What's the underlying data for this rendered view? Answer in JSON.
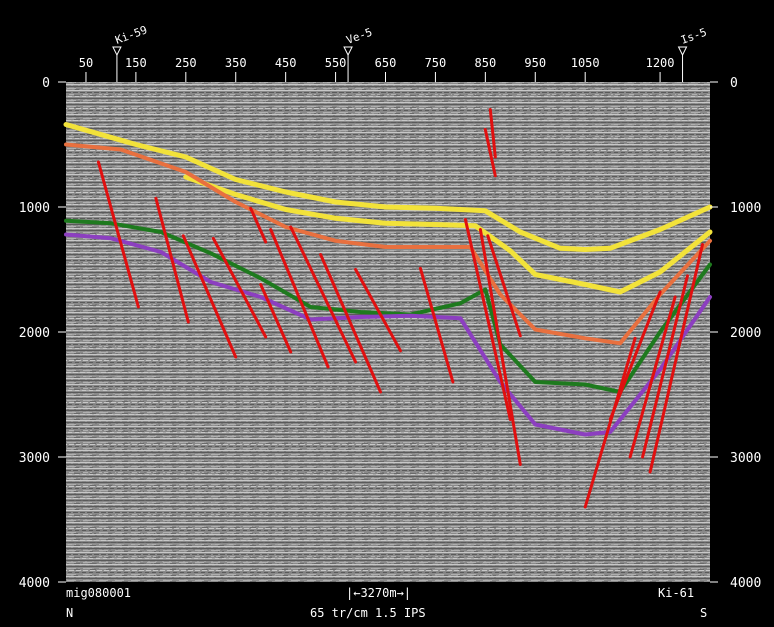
{
  "wells": [
    {
      "name": "Ki-59",
      "trace": 112
    },
    {
      "name": "Ve-5",
      "trace": 575
    },
    {
      "name": "Is-5",
      "trace": 1245
    }
  ],
  "trace_axis": {
    "ticks": [
      50,
      150,
      250,
      350,
      450,
      550,
      650,
      750,
      850,
      950,
      1050,
      1200
    ],
    "min": 10,
    "max": 1300
  },
  "time_axis": {
    "ticks": [
      0,
      1000,
      2000,
      3000,
      4000
    ],
    "min": 0,
    "max": 4000
  },
  "footer": {
    "line_name": "mig080001",
    "scale_bar": "|←3270m→|",
    "end_label": "Ki-61",
    "left_direction": "N",
    "right_direction": "S",
    "display_params": "65 tr/cm 1.5 IPS"
  },
  "colors": {
    "background": "#000000",
    "seismic": "#8a8a8a",
    "horizon_yellow": "#f2e23a",
    "horizon_orange": "#e8703f",
    "horizon_green": "#1e7a1e",
    "horizon_purple": "#8c3fc0",
    "fault": "#e01010"
  },
  "horizons": [
    {
      "color": "horizon_yellow",
      "width": 5,
      "points": [
        [
          10,
          340
        ],
        [
          150,
          500
        ],
        [
          250,
          600
        ],
        [
          350,
          780
        ],
        [
          450,
          880
        ],
        [
          550,
          960
        ],
        [
          650,
          1000
        ],
        [
          750,
          1010
        ],
        [
          850,
          1030
        ],
        [
          920,
          1200
        ],
        [
          1000,
          1330
        ],
        [
          1050,
          1340
        ],
        [
          1100,
          1330
        ],
        [
          1200,
          1180
        ],
        [
          1300,
          1000
        ]
      ]
    },
    {
      "color": "horizon_yellow",
      "width": 5,
      "points": [
        [
          250,
          760
        ],
        [
          350,
          900
        ],
        [
          450,
          1020
        ],
        [
          550,
          1090
        ],
        [
          650,
          1130
        ],
        [
          750,
          1140
        ],
        [
          830,
          1150
        ],
        [
          900,
          1350
        ],
        [
          950,
          1540
        ],
        [
          1050,
          1620
        ],
        [
          1120,
          1680
        ],
        [
          1200,
          1520
        ],
        [
          1300,
          1200
        ]
      ]
    },
    {
      "color": "horizon_orange",
      "width": 4,
      "points": [
        [
          10,
          500
        ],
        [
          120,
          540
        ],
        [
          250,
          720
        ],
        [
          350,
          960
        ],
        [
          450,
          1160
        ],
        [
          550,
          1270
        ],
        [
          650,
          1320
        ],
        [
          750,
          1320
        ],
        [
          820,
          1320
        ],
        [
          880,
          1700
        ],
        [
          950,
          1980
        ],
        [
          1050,
          2050
        ],
        [
          1120,
          2090
        ],
        [
          1200,
          1700
        ],
        [
          1300,
          1270
        ]
      ]
    },
    {
      "color": "horizon_green",
      "width": 4,
      "points": [
        [
          10,
          1110
        ],
        [
          100,
          1130
        ],
        [
          200,
          1200
        ],
        [
          300,
          1370
        ],
        [
          400,
          1570
        ],
        [
          500,
          1800
        ],
        [
          600,
          1840
        ],
        [
          700,
          1860
        ],
        [
          800,
          1770
        ],
        [
          850,
          1660
        ],
        [
          880,
          2100
        ],
        [
          950,
          2400
        ],
        [
          1050,
          2420
        ],
        [
          1120,
          2480
        ],
        [
          1200,
          2000
        ],
        [
          1300,
          1460
        ]
      ]
    },
    {
      "color": "horizon_purple",
      "width": 4,
      "points": [
        [
          10,
          1220
        ],
        [
          100,
          1250
        ],
        [
          200,
          1360
        ],
        [
          300,
          1600
        ],
        [
          400,
          1720
        ],
        [
          500,
          1900
        ],
        [
          600,
          1880
        ],
        [
          700,
          1870
        ],
        [
          800,
          1890
        ],
        [
          880,
          2400
        ],
        [
          950,
          2740
        ],
        [
          1050,
          2820
        ],
        [
          1100,
          2800
        ],
        [
          1200,
          2300
        ],
        [
          1300,
          1720
        ]
      ]
    }
  ],
  "faults": [
    [
      [
        75,
        640
      ],
      [
        155,
        1800
      ]
    ],
    [
      [
        190,
        930
      ],
      [
        255,
        1920
      ]
    ],
    [
      [
        245,
        1230
      ],
      [
        350,
        2200
      ]
    ],
    [
      [
        305,
        1250
      ],
      [
        410,
        2040
      ]
    ],
    [
      [
        380,
        1010
      ],
      [
        410,
        1280
      ]
    ],
    [
      [
        420,
        1180
      ],
      [
        535,
        2280
      ]
    ],
    [
      [
        400,
        1620
      ],
      [
        460,
        2160
      ]
    ],
    [
      [
        460,
        1160
      ],
      [
        590,
        2240
      ]
    ],
    [
      [
        520,
        1380
      ],
      [
        640,
        2480
      ]
    ],
    [
      [
        590,
        1500
      ],
      [
        680,
        2150
      ]
    ],
    [
      [
        720,
        1490
      ],
      [
        785,
        2400
      ]
    ],
    [
      [
        810,
        1100
      ],
      [
        900,
        2700
      ]
    ],
    [
      [
        840,
        1180
      ],
      [
        920,
        3060
      ]
    ],
    [
      [
        855,
        1230
      ],
      [
        920,
        2030
      ]
    ],
    [
      [
        850,
        380
      ],
      [
        870,
        750
      ]
    ],
    [
      [
        860,
        220
      ],
      [
        870,
        600
      ]
    ],
    [
      [
        1050,
        3400
      ],
      [
        1150,
        2050
      ]
    ],
    [
      [
        1100,
        2700
      ],
      [
        1200,
        1680
      ]
    ],
    [
      [
        1140,
        3000
      ],
      [
        1230,
        1720
      ]
    ],
    [
      [
        1165,
        3000
      ],
      [
        1255,
        1550
      ]
    ],
    [
      [
        1180,
        3120
      ],
      [
        1285,
        1300
      ]
    ]
  ]
}
